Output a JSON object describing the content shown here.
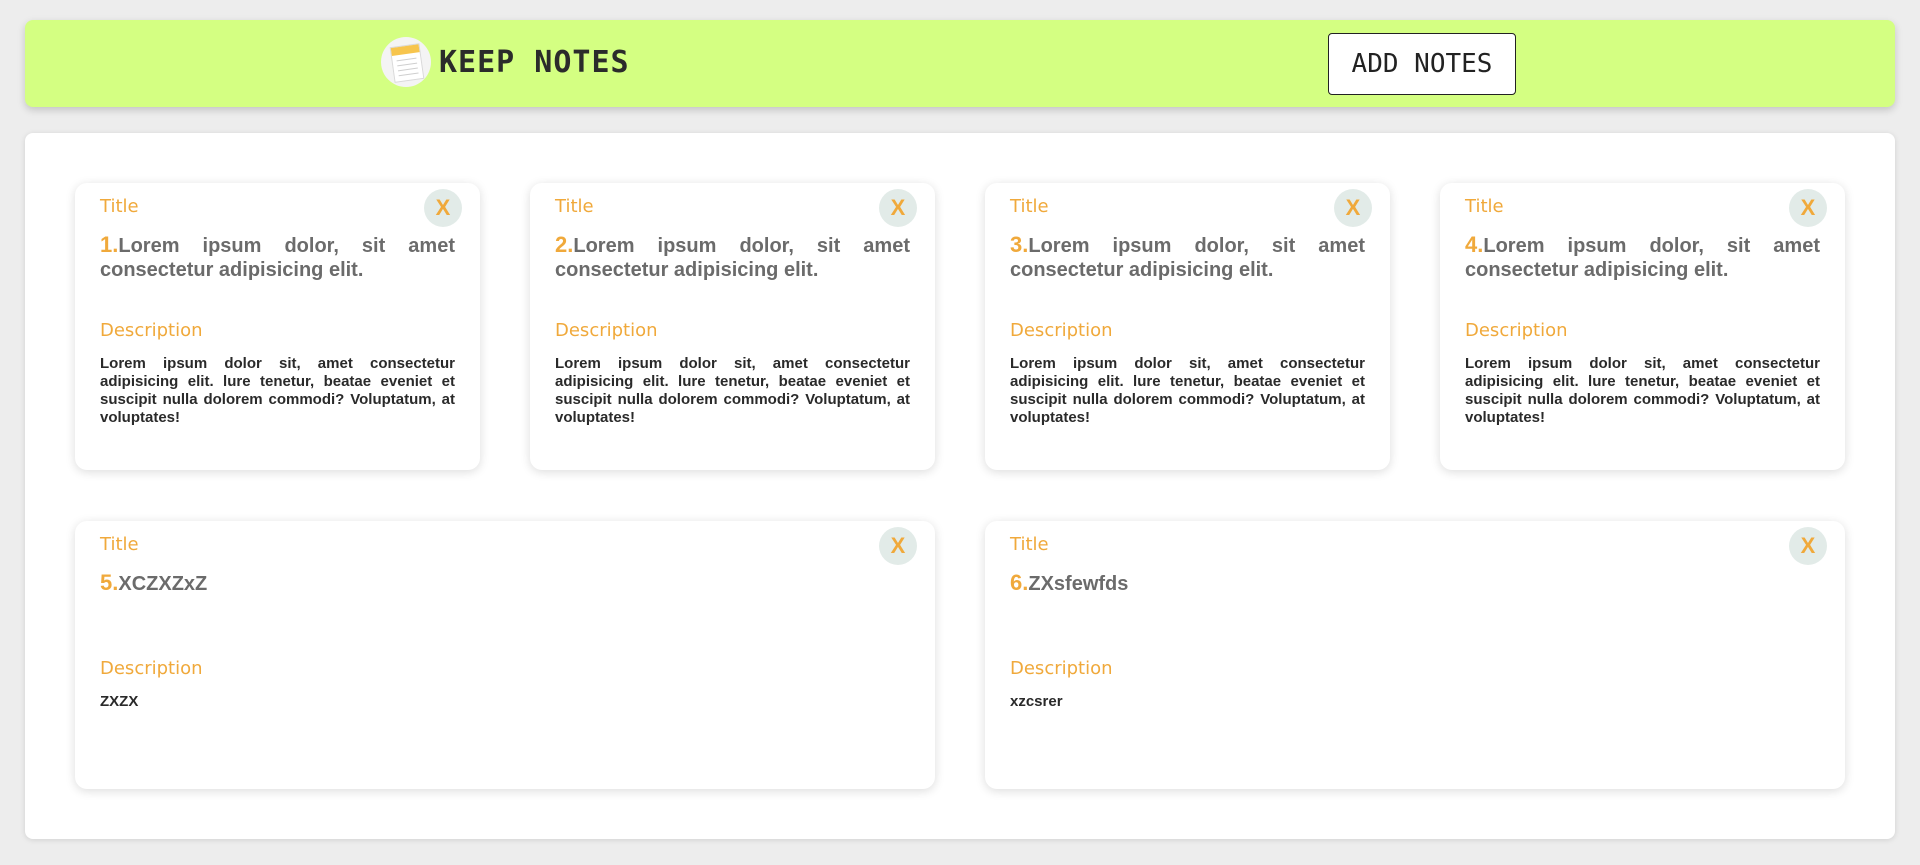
{
  "header": {
    "app_title": "KEEP NOTES",
    "logo_icon": "notepad-icon",
    "add_button_label": "ADD NOTES",
    "background_color": "#d4ff82"
  },
  "labels": {
    "title": "Title",
    "description": "Description",
    "close": "X"
  },
  "accent_color": "#f0a93b",
  "notes": [
    {
      "number": "1.",
      "title": "Lorem ipsum dolor, sit amet consectetur adipisicing elit.",
      "description": "Lorem ipsum dolor sit, amet consectetur adipisicing elit. lure tenetur, beatae eveniet et suscipit nulla dolorem commodi? Voluptatum, at voluptates!"
    },
    {
      "number": "2.",
      "title": "Lorem ipsum dolor, sit amet consectetur adipisicing elit.",
      "description": "Lorem ipsum dolor sit, amet consectetur adipisicing elit. lure tenetur, beatae eveniet et suscipit nulla dolorem commodi? Voluptatum, at voluptates!"
    },
    {
      "number": "3.",
      "title": "Lorem ipsum dolor, sit amet consectetur adipisicing elit.",
      "description": "Lorem ipsum dolor sit, amet consectetur adipisicing elit. lure tenetur, beatae eveniet et suscipit nulla dolorem commodi? Voluptatum, at voluptates!"
    },
    {
      "number": "4.",
      "title": "Lorem ipsum dolor, sit amet consectetur adipisicing elit.",
      "description": "Lorem ipsum dolor sit, amet consectetur adipisicing elit. lure tenetur, beatae eveniet et suscipit nulla dolorem commodi? Voluptatum, at voluptates!"
    },
    {
      "number": "5.",
      "title": "XCZXZxZ",
      "description": "ZXZX"
    },
    {
      "number": "6.",
      "title": "ZXsfewfds",
      "description": "xzcsrer"
    }
  ]
}
